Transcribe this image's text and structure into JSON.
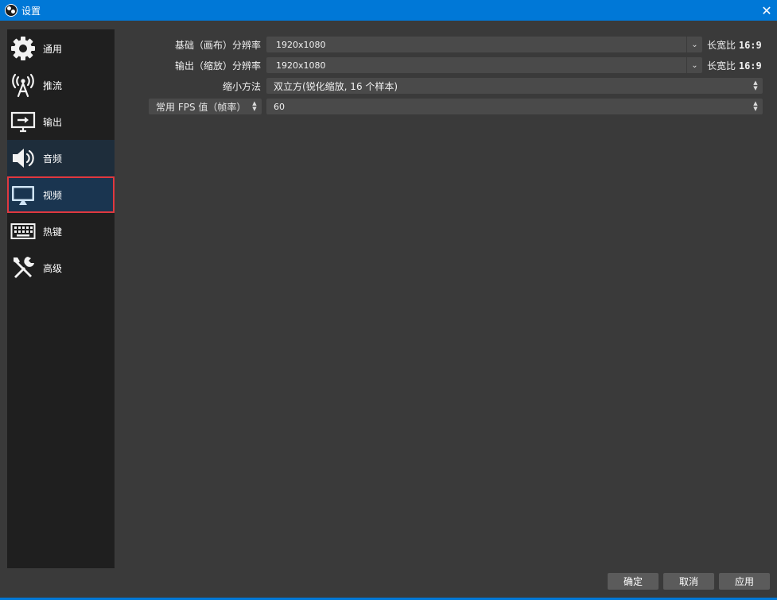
{
  "window": {
    "title": "设置",
    "close_glyph": "✕",
    "colors": {
      "titlebar": "#0078d7",
      "sidebar": "#1f1f1f",
      "selected_outline": "#e0383f",
      "panel": "#3a3a3a"
    }
  },
  "sidebar": {
    "items": [
      {
        "label": "通用",
        "icon": "gear-icon"
      },
      {
        "label": "推流",
        "icon": "broadcast-antenna-icon"
      },
      {
        "label": "输出",
        "icon": "output-monitor-icon"
      },
      {
        "label": "音频",
        "icon": "speaker-icon"
      },
      {
        "label": "视频",
        "icon": "monitor-icon",
        "selected": true
      },
      {
        "label": "热键",
        "icon": "keyboard-icon"
      },
      {
        "label": "高级",
        "icon": "tools-icon"
      }
    ]
  },
  "video": {
    "base_resolution": {
      "label": "基础（画布）分辨率",
      "value": "1920x1080",
      "aspect_label": "长宽比",
      "aspect_value": "16:9"
    },
    "output_resolution": {
      "label": "输出（缩放）分辨率",
      "value": "1920x1080",
      "aspect_label": "长宽比",
      "aspect_value": "16:9"
    },
    "downscale_filter": {
      "label": "缩小方法",
      "value": "双立方(锐化缩放, 16 个样本)"
    },
    "fps": {
      "type_label": "常用 FPS 值（帧率）",
      "value": "60"
    }
  },
  "buttons": {
    "ok": "确定",
    "cancel": "取消",
    "apply": "应用"
  }
}
